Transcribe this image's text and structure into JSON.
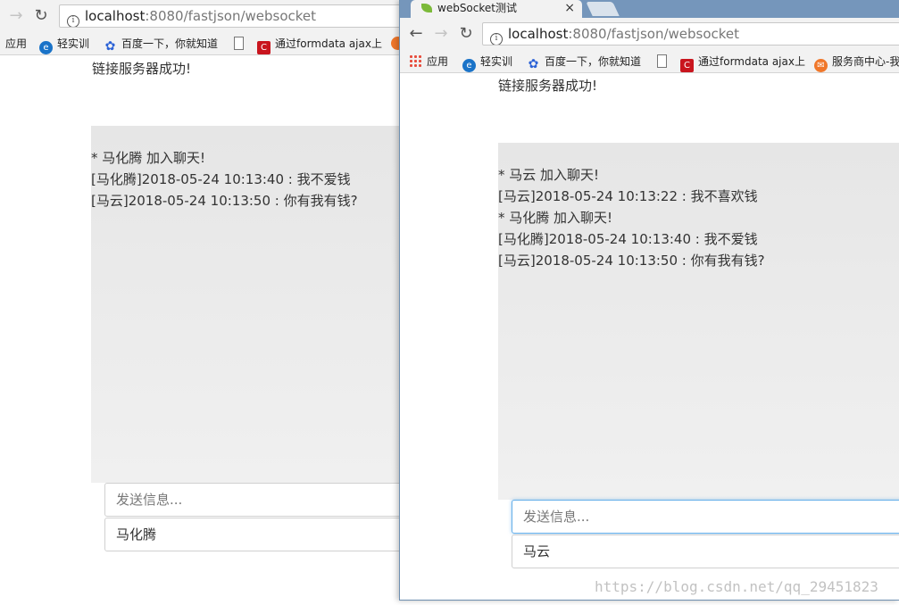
{
  "left_window": {
    "url_host": "localhost",
    "url_path": ":8080/fastjson/websocket",
    "bookmarks": [
      {
        "label": "应用",
        "icon": "apps-icon"
      },
      {
        "label": "轻实训",
        "icon": "qingshixun-icon"
      },
      {
        "label": "百度一下，你就知道",
        "icon": "baidu-paw-icon"
      },
      {
        "label": "",
        "icon": "document-icon"
      },
      {
        "label": "通过formdata ajax上",
        "icon": "csdn-icon"
      }
    ],
    "status": "链接服务器成功!",
    "messages": [
      "* 马化腾 加入聊天!",
      "[马化腾]2018-05-24 10:13:40 : 我不爱钱",
      "[马云]2018-05-24 10:13:50 : 你有我有钱?"
    ],
    "message_placeholder": "发送信息...",
    "username": "马化腾"
  },
  "right_window": {
    "tab_title": "webSocket测试",
    "tab_close": "×",
    "url_host": "localhost",
    "url_path": ":8080/fastjson/websocket",
    "bookmarks": [
      {
        "label": "应用",
        "icon": "apps-icon"
      },
      {
        "label": "轻实训",
        "icon": "qingshixun-icon"
      },
      {
        "label": "百度一下，你就知道",
        "icon": "baidu-paw-icon"
      },
      {
        "label": "",
        "icon": "document-icon"
      },
      {
        "label": "通过formdata ajax上",
        "icon": "csdn-icon"
      },
      {
        "label": "服务商中心-我",
        "icon": "service-icon"
      }
    ],
    "status": "链接服务器成功!",
    "messages": [
      "* 马云 加入聊天!",
      "[马云]2018-05-24 10:13:22 : 我不喜欢钱",
      "* 马化腾 加入聊天!",
      "[马化腾]2018-05-24 10:13:40 : 我不爱钱",
      "[马云]2018-05-24 10:13:50 : 你有我有钱?"
    ],
    "message_placeholder": "发送信息...",
    "username": "马云"
  },
  "watermark": "https://blog.csdn.net/qq_29451823"
}
